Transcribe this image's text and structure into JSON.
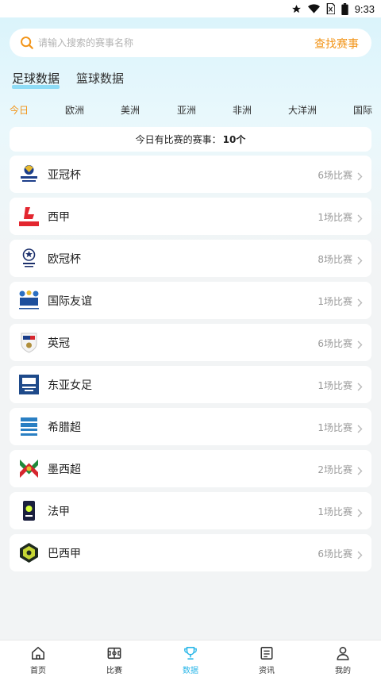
{
  "status_bar": {
    "time": "9:33"
  },
  "search": {
    "placeholder": "请输入搜索的赛事名称",
    "button_label": "查找赛事"
  },
  "sport_tabs": [
    {
      "label": "足球数据",
      "active": true
    },
    {
      "label": "篮球数据",
      "active": false
    }
  ],
  "region_tabs": [
    {
      "label": "今日",
      "active": true
    },
    {
      "label": "欧洲",
      "active": false
    },
    {
      "label": "美洲",
      "active": false
    },
    {
      "label": "亚洲",
      "active": false
    },
    {
      "label": "非洲",
      "active": false
    },
    {
      "label": "大洋洲",
      "active": false
    },
    {
      "label": "国际",
      "active": false
    }
  ],
  "summary": {
    "label": "今日有比赛的赛事：",
    "count": "10个"
  },
  "leagues": [
    {
      "name": "亚冠杯",
      "count": "6场比赛",
      "logo": "afc-champions-league-logo"
    },
    {
      "name": "西甲",
      "count": "1场比赛",
      "logo": "laliga-logo"
    },
    {
      "name": "欧冠杯",
      "count": "8场比赛",
      "logo": "uefa-champions-league-logo"
    },
    {
      "name": "国际友谊",
      "count": "1场比赛",
      "logo": "fifa-logo"
    },
    {
      "name": "英冠",
      "count": "6场比赛",
      "logo": "efl-championship-logo"
    },
    {
      "name": "东亚女足",
      "count": "1场比赛",
      "logo": "eaff-logo"
    },
    {
      "name": "希腊超",
      "count": "1场比赛",
      "logo": "super-league-greece-logo"
    },
    {
      "name": "墨西超",
      "count": "2场比赛",
      "logo": "liga-mx-logo"
    },
    {
      "name": "法甲",
      "count": "1场比赛",
      "logo": "ligue-1-logo"
    },
    {
      "name": "巴西甲",
      "count": "6场比赛",
      "logo": "brasileirao-logo"
    }
  ],
  "bottom_nav": [
    {
      "label": "首页",
      "icon": "home-icon",
      "active": false
    },
    {
      "label": "比赛",
      "icon": "pitch-icon",
      "active": false
    },
    {
      "label": "数据",
      "icon": "trophy-icon",
      "active": true
    },
    {
      "label": "资讯",
      "icon": "news-icon",
      "active": false
    },
    {
      "label": "我的",
      "icon": "profile-icon",
      "active": false
    }
  ],
  "colors": {
    "accent_orange": "#f29418",
    "accent_blue": "#29b6e8",
    "muted_text": "#9a9a9a"
  }
}
